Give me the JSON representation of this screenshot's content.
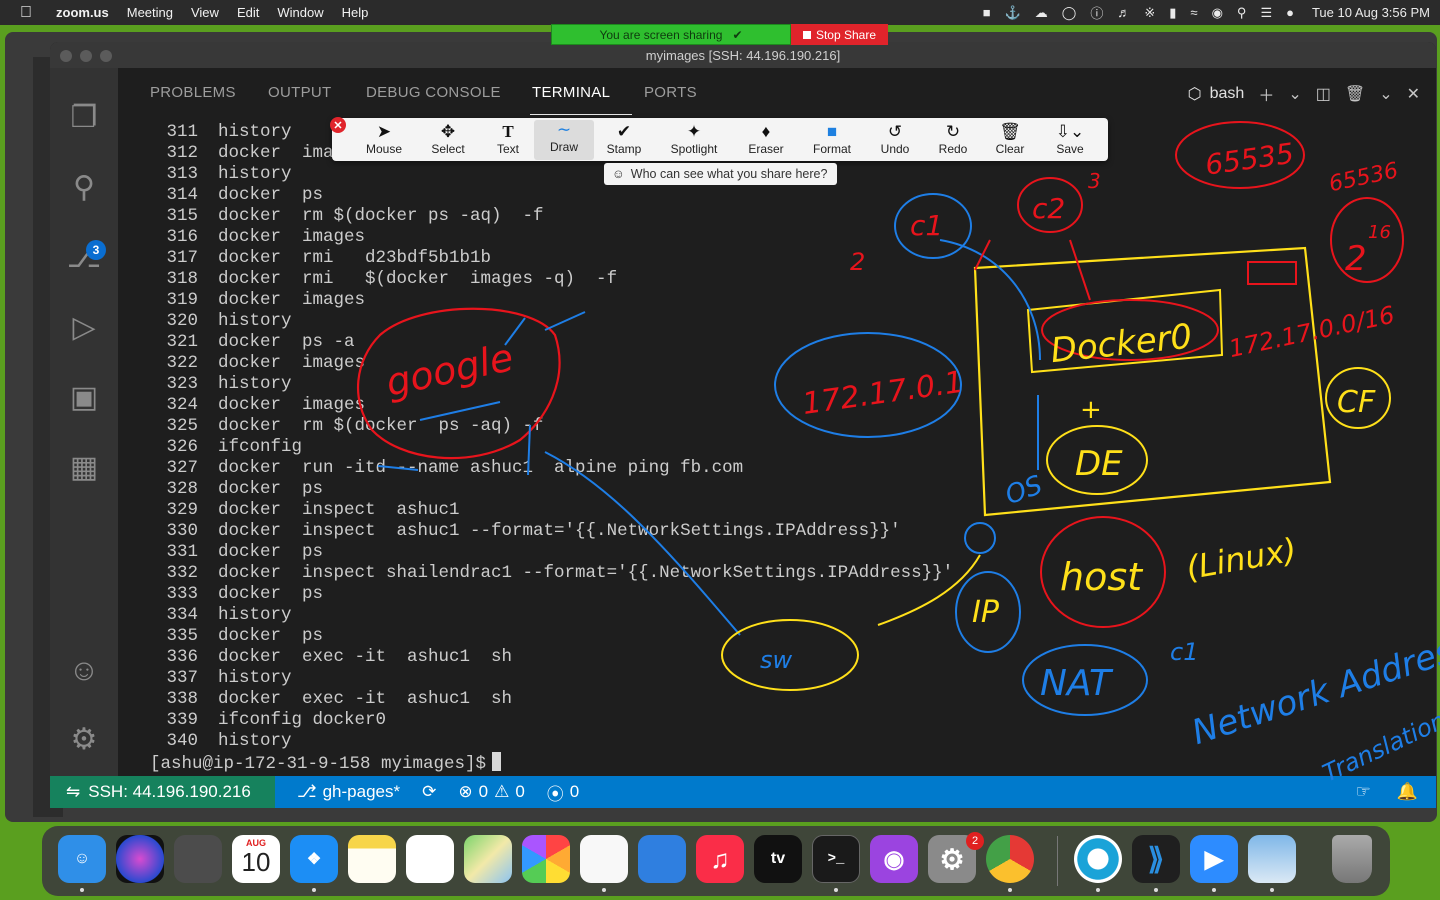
{
  "menubar": {
    "app": "zoom.us",
    "menus": [
      "Meeting",
      "View",
      "Edit",
      "Window",
      "Help"
    ],
    "clock": "Tue 10 Aug  3:56 PM"
  },
  "share_banner": {
    "status": "You are screen sharing",
    "stop_label": "Stop Share"
  },
  "window": {
    "title": "myimages [SSH: 44.196.190.216]"
  },
  "activity": {
    "source_control_badge": "3"
  },
  "panel": {
    "tabs": [
      "PROBLEMS",
      "OUTPUT",
      "DEBUG CONSOLE",
      "TERMINAL",
      "PORTS"
    ],
    "active_tab": "TERMINAL",
    "shell": "bash"
  },
  "annotation_toolbar": {
    "tools": [
      "Mouse",
      "Select",
      "Text",
      "Draw",
      "Stamp",
      "Spotlight",
      "Eraser",
      "Format",
      "Undo",
      "Redo",
      "Clear",
      "Save"
    ],
    "active": "Draw",
    "hint": "Who can see what you share here?"
  },
  "terminal": {
    "lines": [
      {
        "n": "311",
        "cmd": "history"
      },
      {
        "n": "312",
        "cmd": "docker  imag"
      },
      {
        "n": "313",
        "cmd": "history"
      },
      {
        "n": "314",
        "cmd": "docker  ps"
      },
      {
        "n": "315",
        "cmd": "docker  rm $(docker ps -aq)  -f"
      },
      {
        "n": "316",
        "cmd": "docker  images"
      },
      {
        "n": "317",
        "cmd": "docker  rmi   d23bdf5b1b1b"
      },
      {
        "n": "318",
        "cmd": "docker  rmi   $(docker  images -q)  -f"
      },
      {
        "n": "319",
        "cmd": "docker  images"
      },
      {
        "n": "320",
        "cmd": "history"
      },
      {
        "n": "321",
        "cmd": "docker  ps -a"
      },
      {
        "n": "322",
        "cmd": "docker  images"
      },
      {
        "n": "323",
        "cmd": "history"
      },
      {
        "n": "324",
        "cmd": "docker  images"
      },
      {
        "n": "325",
        "cmd": "docker  rm $(docker  ps -aq) -f"
      },
      {
        "n": "326",
        "cmd": "ifconfig"
      },
      {
        "n": "327",
        "cmd": "docker  run -itd --name ashuc1  alpine ping fb.com"
      },
      {
        "n": "328",
        "cmd": "docker  ps"
      },
      {
        "n": "329",
        "cmd": "docker  inspect  ashuc1"
      },
      {
        "n": "330",
        "cmd": "docker  inspect  ashuc1 --format='{{.NetworkSettings.IPAddress}}'"
      },
      {
        "n": "331",
        "cmd": "docker  ps"
      },
      {
        "n": "332",
        "cmd": "docker  inspect shailendrac1 --format='{{.NetworkSettings.IPAddress}}'"
      },
      {
        "n": "333",
        "cmd": "docker  ps"
      },
      {
        "n": "334",
        "cmd": "history"
      },
      {
        "n": "335",
        "cmd": "docker  ps"
      },
      {
        "n": "336",
        "cmd": "docker  exec -it  ashuc1  sh"
      },
      {
        "n": "337",
        "cmd": "history"
      },
      {
        "n": "338",
        "cmd": "docker  exec -it  ashuc1  sh"
      },
      {
        "n": "339",
        "cmd": "ifconfig docker0"
      },
      {
        "n": "340",
        "cmd": "history"
      }
    ],
    "prompt": "[ashu@ip-172-31-9-158 myimages]$"
  },
  "statusbar": {
    "remote": "SSH: 44.196.190.216",
    "branch": "gh-pages*",
    "errors": "0",
    "warnings": "0",
    "ports": "0"
  },
  "annotations": {
    "ip_bridge": "172.17.0.1",
    "docker_iface": "Docker0",
    "subnet": "172.17.0.0/16",
    "max_port": "65535",
    "max_port_alt": "65536",
    "power": "2",
    "exponent": "16",
    "c1": "c1",
    "c2": "c2",
    "num_2": "2",
    "num_3": "3",
    "de": "DE",
    "cf": "CF",
    "host": "host",
    "linux": "(Linux)",
    "nat": "NAT",
    "network_address": "Network Address",
    "translation": "Translation",
    "google": "google",
    "os": "OS",
    "ip": "IP",
    "sw": "sw"
  },
  "dock": {
    "calendar_month": "AUG",
    "calendar_day": "10",
    "settings_badge": "2"
  }
}
